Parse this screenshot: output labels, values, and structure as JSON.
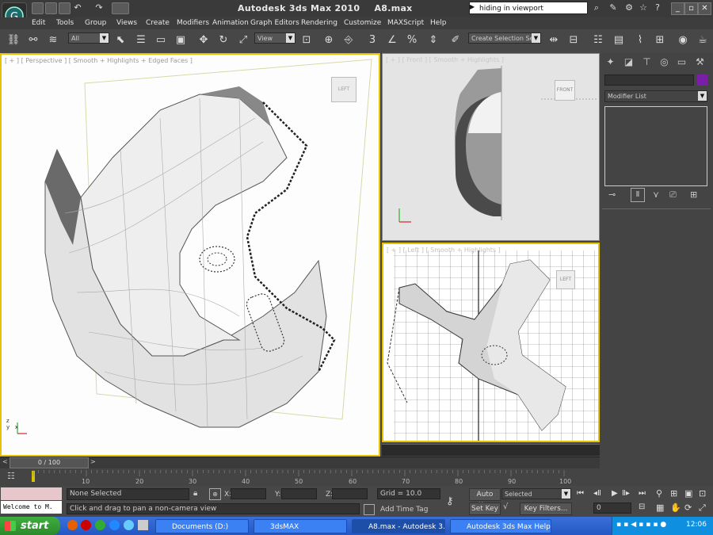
{
  "window": {
    "title_app": "Autodesk 3ds Max  2010",
    "title_file": "A8.max",
    "search_text": "hiding in viewport"
  },
  "menu": [
    "Edit",
    "Tools",
    "Group",
    "Views",
    "Create",
    "Modifiers",
    "Animation",
    "Graph Editors",
    "Rendering",
    "Customize",
    "MAXScript",
    "Help"
  ],
  "toolbar": {
    "selection_filter": "All",
    "ref_coord": "View",
    "snap_number": "3",
    "named_selection": "Create Selection Se"
  },
  "viewports": {
    "perspective": "[ + ] [ Perspective ] [ Smooth + Highlights + Edged Faces ]",
    "front": "[ + ] [ Front ] [ Smooth + Highlights ]",
    "left": "[ + ] [ Left ] [ Smooth + Highlights ]",
    "front_cube": "FRONT",
    "left_cube": "LEFT",
    "persp_cube": "LEFT"
  },
  "command_panel": {
    "modifier_list": "Modifier List",
    "object_color": "#7a1ea8"
  },
  "timeline": {
    "frame_display": "0 / 100",
    "ticks": [
      "10",
      "20",
      "30",
      "40",
      "50",
      "60",
      "70",
      "80",
      "90",
      "100"
    ]
  },
  "status": {
    "maxscript": "Welcome to M.",
    "selection": "None Selected",
    "prompt": "Click and drag to pan a non-camera view",
    "x_label": "X:",
    "y_label": "Y:",
    "z_label": "Z:",
    "grid": "Grid = 10.0",
    "add_time_tag": "Add Time Tag",
    "auto_key": "Auto Key",
    "set_key": "Set Key",
    "key_mode": "Selected",
    "key_filters": "Key Filters...",
    "frame": "0"
  },
  "taskbar": {
    "start": "start",
    "tasks": [
      "Documents (D:)",
      "3dsMAX",
      "A8.max - Autodesk 3...",
      "Autodesk 3ds Max Help"
    ],
    "clock": "12:06"
  }
}
